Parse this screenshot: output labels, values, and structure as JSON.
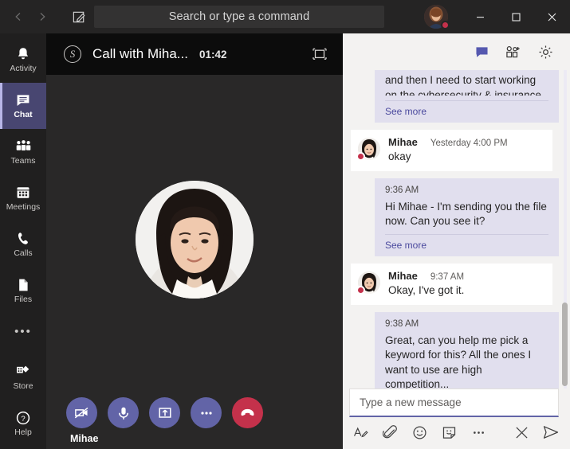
{
  "titlebar": {
    "back_icon": "chevron-left-icon",
    "forward_icon": "chevron-right-icon",
    "compose_icon": "compose-pencil-icon",
    "search_placeholder": "Search or type a command",
    "avatar_status": "busy",
    "minimize_label": "–",
    "maximize_label": "□",
    "close_label": "✕"
  },
  "rail": {
    "items": [
      {
        "id": "activity",
        "label": "Activity",
        "icon": "bell-icon",
        "active": false
      },
      {
        "id": "chat",
        "label": "Chat",
        "icon": "chat-bubble-icon",
        "active": true
      },
      {
        "id": "teams",
        "label": "Teams",
        "icon": "people-icon",
        "active": false
      },
      {
        "id": "meetings",
        "label": "Meetings",
        "icon": "calendar-icon",
        "active": false
      },
      {
        "id": "calls",
        "label": "Calls",
        "icon": "phone-icon",
        "active": false
      },
      {
        "id": "files",
        "label": "Files",
        "icon": "file-icon",
        "active": false
      }
    ],
    "more_label": "•••",
    "bottom": [
      {
        "id": "store",
        "label": "Store",
        "icon": "store-icon"
      },
      {
        "id": "help",
        "label": "Help",
        "icon": "help-circle-icon"
      }
    ]
  },
  "call": {
    "app_icon": "skype-icon",
    "title": "Call with Miha...",
    "timer": "01:42",
    "expand_icon": "fit-to-screen-icon",
    "participant_name": "Mihae",
    "controls": [
      {
        "id": "video",
        "icon": "camera-off-icon",
        "style": "purple"
      },
      {
        "id": "mic",
        "icon": "microphone-icon",
        "style": "purple"
      },
      {
        "id": "share",
        "icon": "share-screen-icon",
        "style": "purple"
      },
      {
        "id": "more",
        "icon": "more-dots-icon",
        "style": "purple"
      },
      {
        "id": "hangup",
        "icon": "hangup-phone-icon",
        "style": "red"
      }
    ]
  },
  "chat": {
    "header_icons": [
      {
        "id": "conversation",
        "icon": "chat-filled-icon",
        "active": true
      },
      {
        "id": "add-people",
        "icon": "add-person-icon",
        "active": false
      },
      {
        "id": "settings",
        "icon": "gear-icon",
        "active": false
      }
    ],
    "messages": [
      {
        "id": "m1",
        "direction": "out",
        "clipped": true,
        "line1": "and then I need to start working",
        "line2": "on the cybersecurity & insurance",
        "see_more": "See more"
      },
      {
        "id": "m2",
        "direction": "in",
        "sender": "Mihae",
        "time": "Yesterday 4:00 PM",
        "text": "okay"
      },
      {
        "id": "m3",
        "direction": "out",
        "time": "9:36 AM",
        "text": "Hi Mihae - I'm sending you the file now. Can you see it?",
        "see_more": "See more"
      },
      {
        "id": "m4",
        "direction": "in",
        "sender": "Mihae",
        "time": "9:37 AM",
        "text": "Okay, I've got it."
      },
      {
        "id": "m5",
        "direction": "out",
        "time": "9:38 AM",
        "text": "Great, can you help me pick a keyword for this? All the ones I want to use are high competition..."
      }
    ]
  },
  "compose": {
    "placeholder": "Type a new message",
    "tools": [
      {
        "id": "format",
        "icon": "format-text-icon"
      },
      {
        "id": "attach",
        "icon": "paperclip-icon"
      },
      {
        "id": "emoji",
        "icon": "smiley-icon"
      },
      {
        "id": "sticker",
        "icon": "sticker-icon"
      },
      {
        "id": "more",
        "icon": "more-dots-icon"
      }
    ],
    "close_icon": "close-icon",
    "send_icon": "send-plane-icon"
  },
  "colors": {
    "accent": "#6264a7",
    "accent_light": "#e1dfee",
    "danger": "#c4314b",
    "rail_bg": "#201f1f",
    "chat_bg": "#f3f2f1"
  }
}
